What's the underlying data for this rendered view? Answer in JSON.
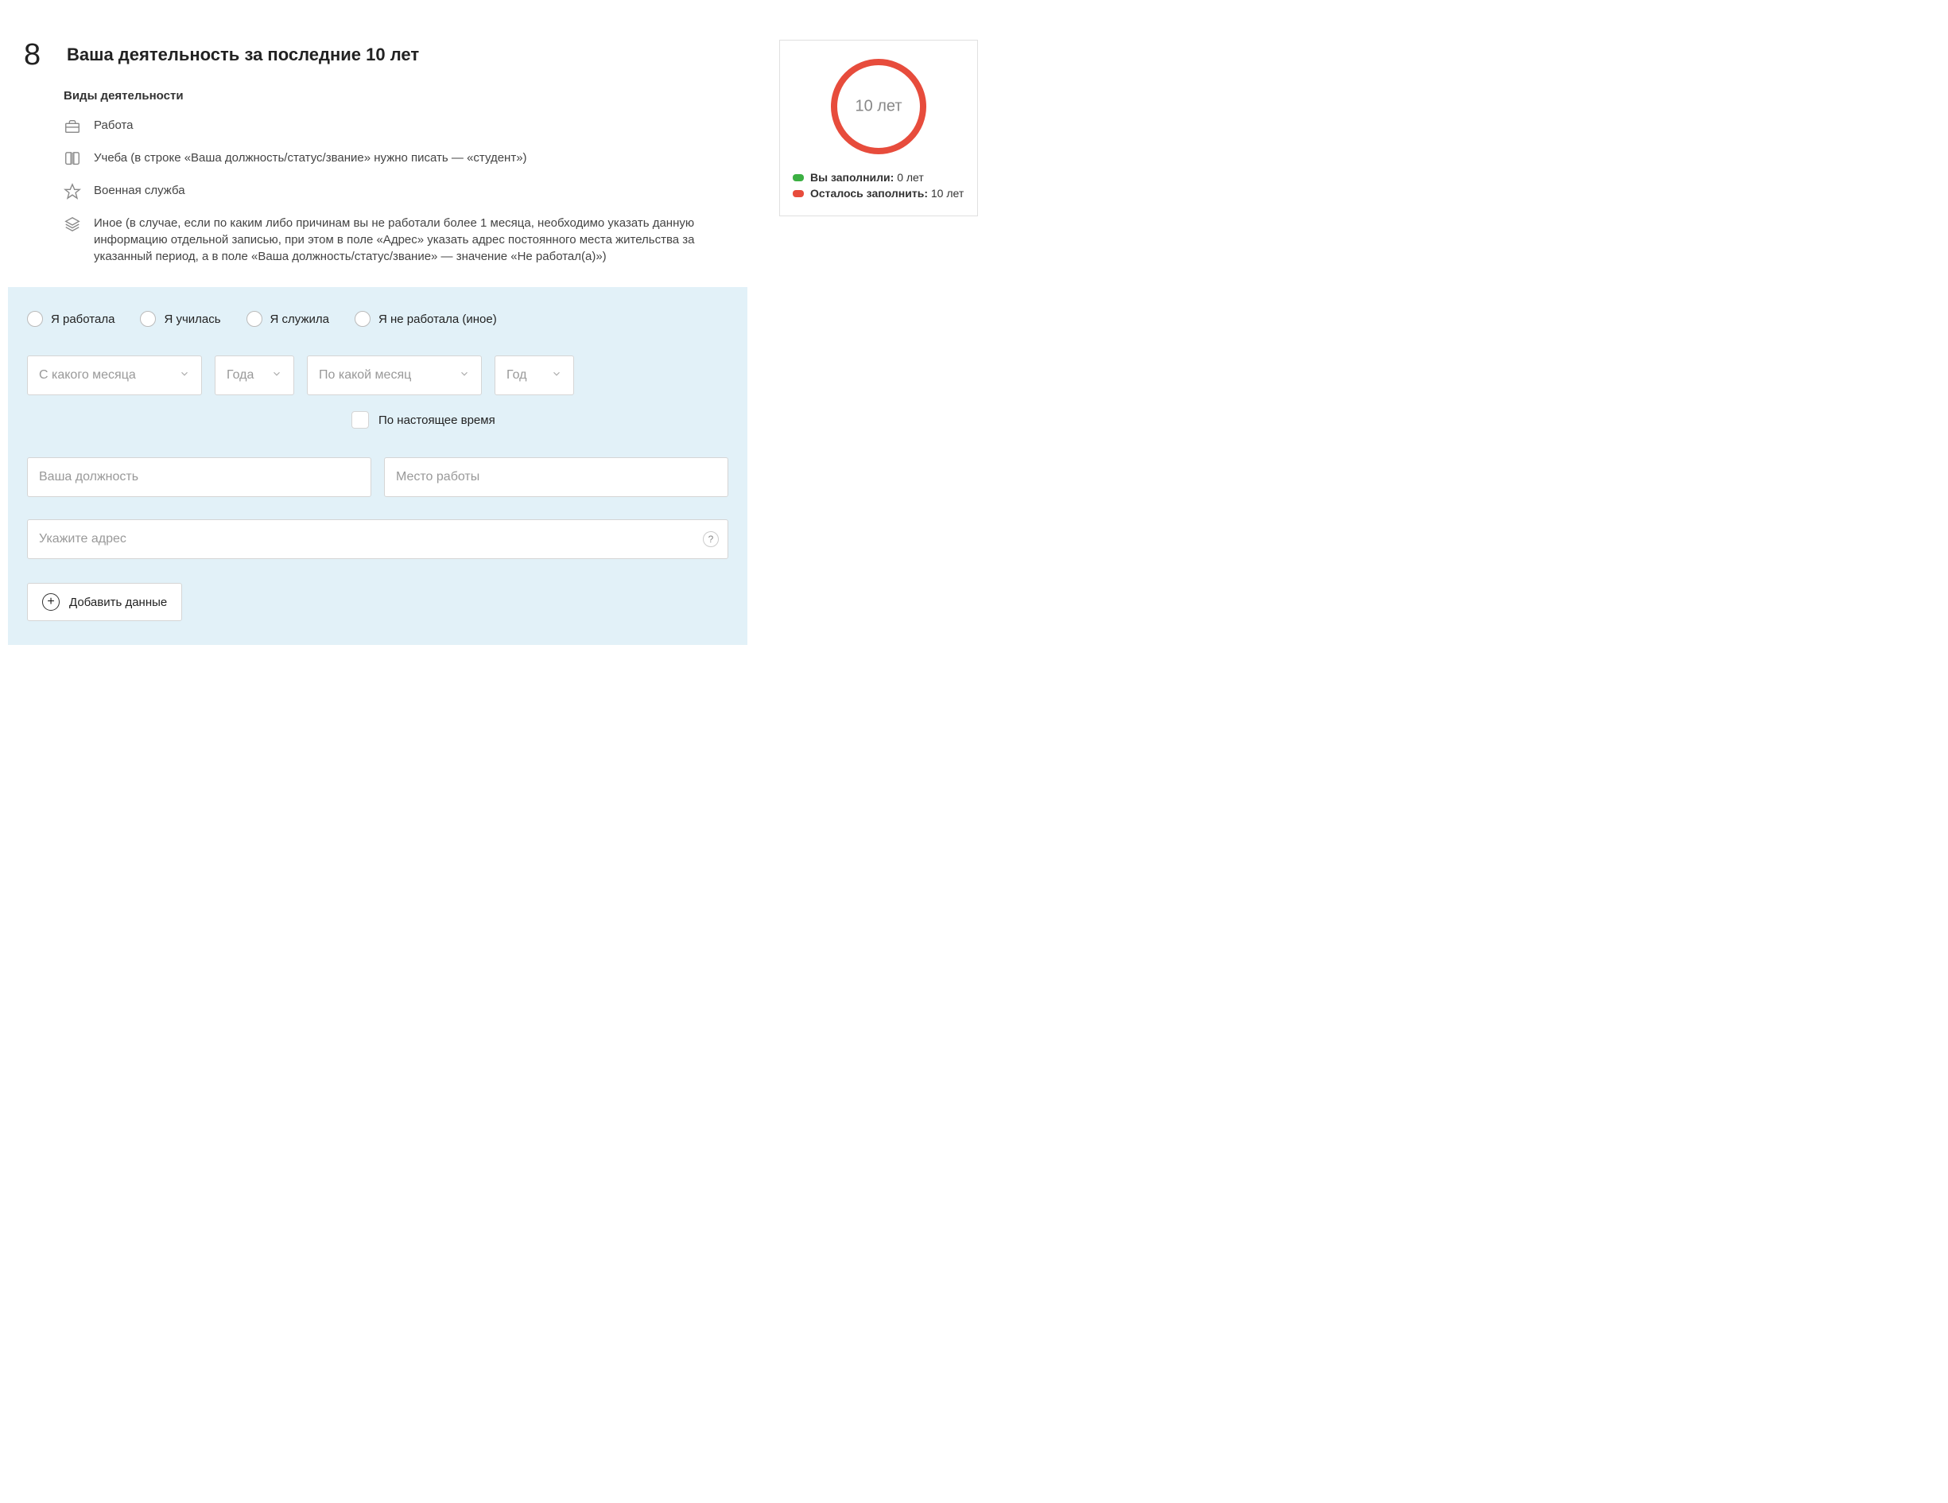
{
  "section": {
    "number": "8",
    "title": "Ваша деятельность за последние 10 лет",
    "subtitle": "Виды деятельности"
  },
  "activities": [
    {
      "icon": "briefcase-icon",
      "text": "Работа"
    },
    {
      "icon": "book-icon",
      "text": "Учеба (в строке «Ваша должность/статус/звание» нужно писать — «студент»)"
    },
    {
      "icon": "star-icon",
      "text": "Военная служба"
    },
    {
      "icon": "stack-icon",
      "text": "Иное (в случае, если по каким либо причинам вы не работали более 1 месяца, необходимо указать данную информацию отдельной записью, при этом в поле «Адрес» указать адрес постоянного места жительства за указанный период, а в поле «Ваша должность/статус/звание» — значение «Не работал(а)»)"
    }
  ],
  "form": {
    "radios": [
      "Я работала",
      "Я училась",
      "Я служила",
      "Я не работала (иное)"
    ],
    "from_month_placeholder": "С какого месяца",
    "from_year_placeholder": "Года",
    "to_month_placeholder": "По какой месяц",
    "to_year_placeholder": "Год",
    "present_checkbox": "По настоящее время",
    "position_placeholder": "Ваша должность",
    "workplace_placeholder": "Место работы",
    "address_placeholder": "Укажите адрес",
    "help_symbol": "?",
    "add_button": "Добавить данные"
  },
  "progress": {
    "ring_label": "10 лет",
    "filled_label": "Вы заполнили:",
    "filled_value": "0 лет",
    "remaining_label": "Осталось заполнить:",
    "remaining_value": "10 лет",
    "colors": {
      "green": "#3cb043",
      "red": "#e74c3c"
    }
  }
}
